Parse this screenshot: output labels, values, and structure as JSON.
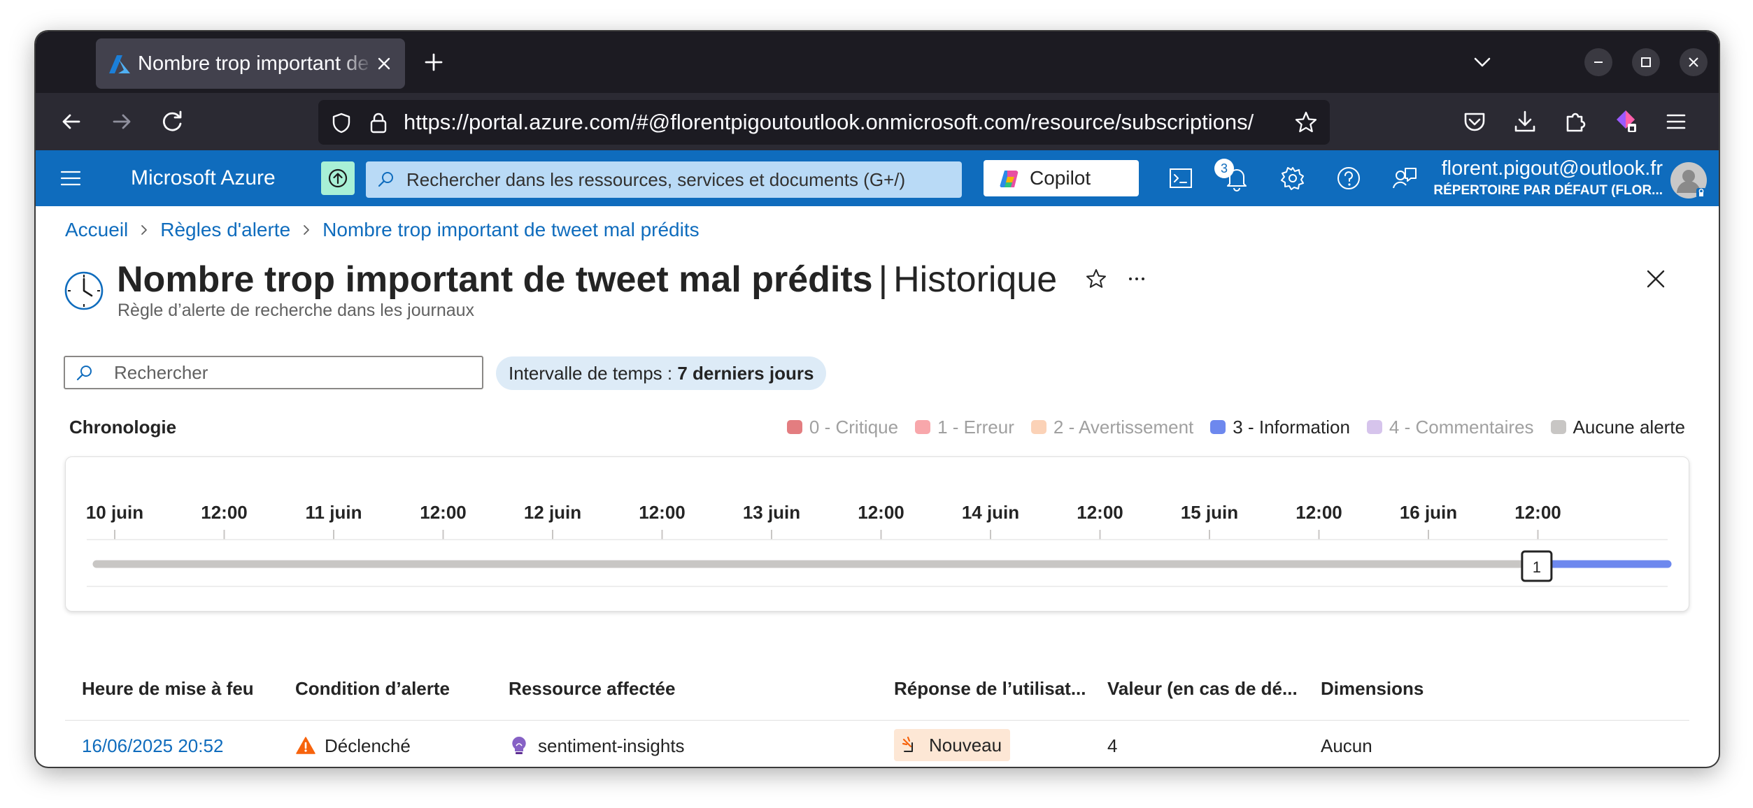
{
  "browser": {
    "tab_title": "Nombre trop important de tweet mal prédits",
    "url": "https://portal.azure.com/#@florentpigoutoutlook.onmicrosoft.com/resource/subscriptions/"
  },
  "azure": {
    "brand": "Microsoft Azure",
    "search_placeholder": "Rechercher dans les ressources, services et documents (G+/)",
    "copilot_label": "Copilot",
    "notification_count": "3",
    "account_email": "florent.pigout@outlook.fr",
    "account_directory": "RÉPERTOIRE PAR DÉFAUT (FLOR..."
  },
  "breadcrumb": {
    "items": [
      "Accueil",
      "Règles d'alerte",
      "Nombre trop important de tweet mal prédits"
    ]
  },
  "page": {
    "title": "Nombre trop important de tweet mal prédits",
    "separator": "|",
    "section": "Historique",
    "subtitle": "Règle d’alerte de recherche dans les journaux"
  },
  "filters": {
    "search_placeholder": "Rechercher",
    "time_label": "Intervalle de temps : ",
    "time_value": "7 derniers jours"
  },
  "timeline": {
    "label": "Chronologie",
    "legend": [
      {
        "label": "0 - Critique",
        "color": "#e37d80",
        "text_color": "#a0a0a0"
      },
      {
        "label": "1 - Erreur",
        "color": "#f8a7ab",
        "text_color": "#a0a0a0"
      },
      {
        "label": "2 - Avertissement",
        "color": "#fbd2b7",
        "text_color": "#a0a0a0"
      },
      {
        "label": "3 - Information",
        "color": "#6d88ee",
        "text_color": "#242424"
      },
      {
        "label": "4 - Commentaires",
        "color": "#d6c4ec",
        "text_color": "#a0a0a0"
      },
      {
        "label": "Aucune alerte",
        "color": "#c8c6c4",
        "text_color": "#242424"
      }
    ],
    "ticks": [
      "10 juin",
      "12:00",
      "11 juin",
      "12:00",
      "12 juin",
      "12:00",
      "13 juin",
      "12:00",
      "14 juin",
      "12:00",
      "15 juin",
      "12:00",
      "16 juin",
      "12:00"
    ],
    "range_fraction_start": 0,
    "info_segment_start_fraction": 0.9345,
    "marker_count": "1"
  },
  "table": {
    "columns": [
      "Heure de mise à feu",
      "Condition d’alerte",
      "Ressource affectée",
      "Réponse de l’utilisat...",
      "Valeur (en cas de dé...",
      "Dimensions"
    ],
    "rows": [
      {
        "fired_time": "16/06/2025 20:52",
        "condition": "Déclenché",
        "resource": "sentiment-insights",
        "response": "Nouveau",
        "value": "4",
        "dimensions": "Aucun"
      }
    ]
  },
  "colors": {
    "azure_blue": "#0f6cbd",
    "info_series": "#6d88ee",
    "no_alert": "#c8c6c4",
    "new_badge_bg": "#fde7d5",
    "warning": "#f7630c"
  }
}
